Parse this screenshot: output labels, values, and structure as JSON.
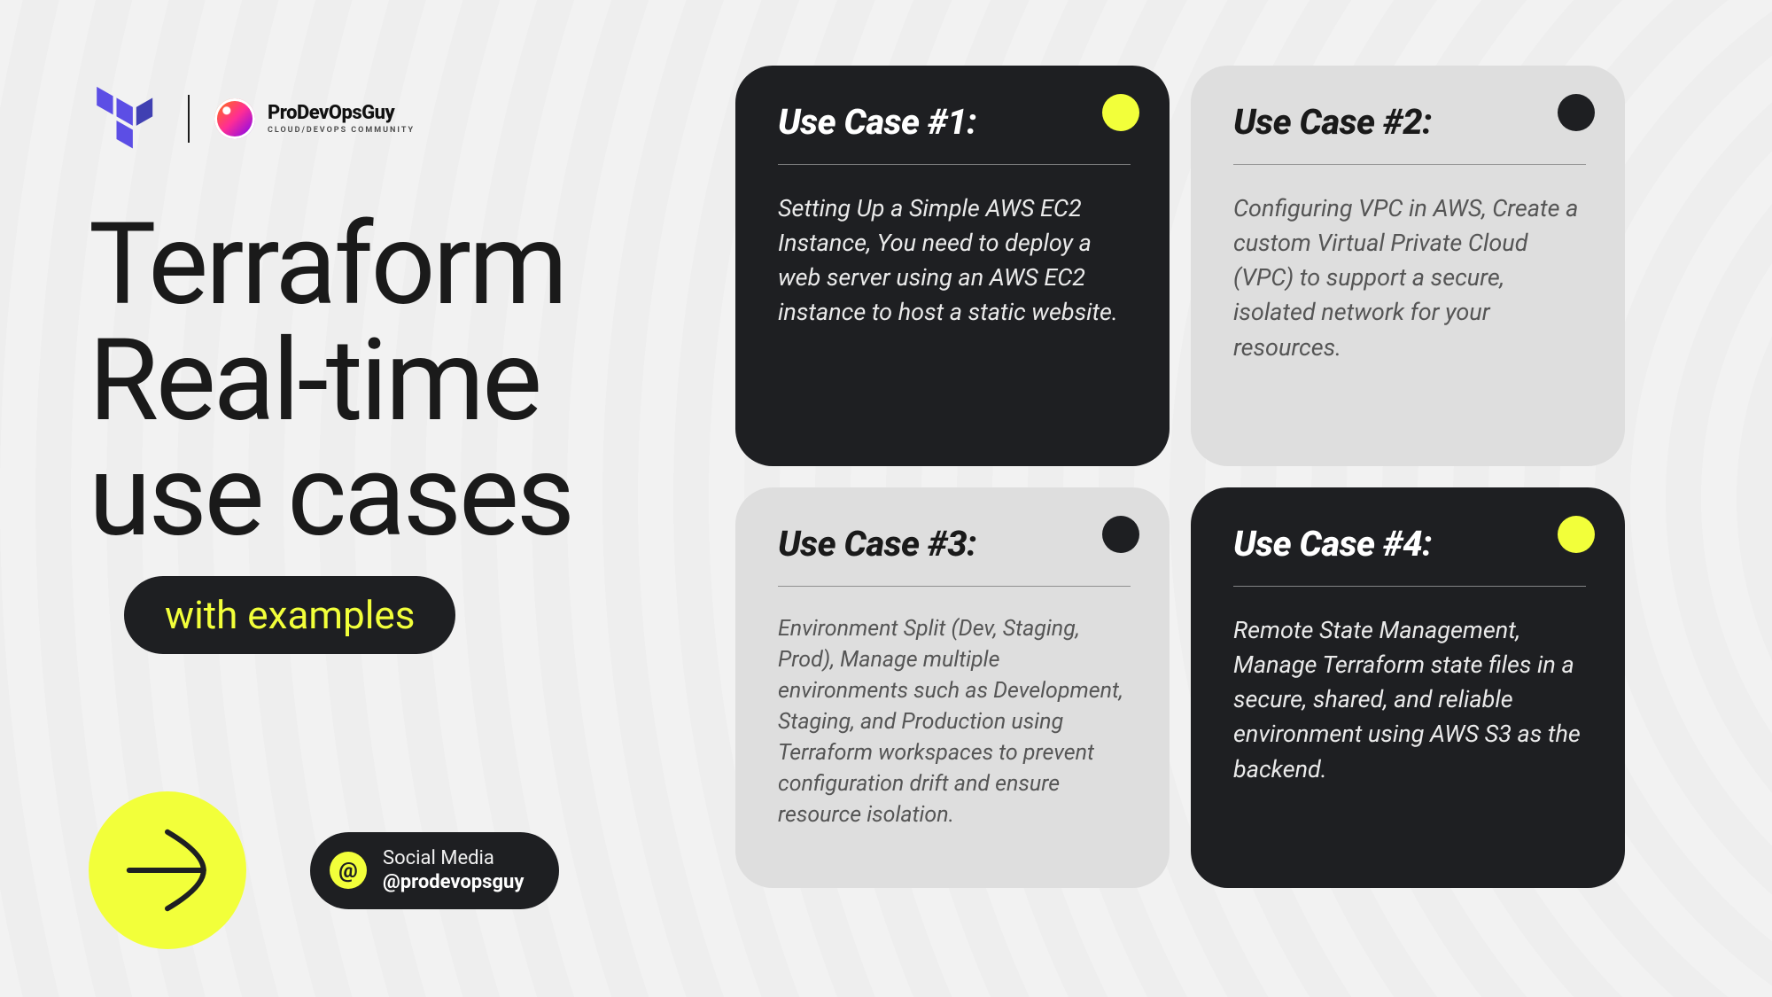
{
  "brand": {
    "name": "ProDevOpsGuy",
    "subtitle": "CLOUD/DEVOPS COMMUNITY"
  },
  "headline": {
    "line1": "Terraform",
    "line2": "Real-time",
    "line3": "use cases",
    "pill": "with examples"
  },
  "social": {
    "at": "@",
    "label": "Social Media",
    "handle": "@prodevopsguy"
  },
  "cards": [
    {
      "title": "Use Case #1:",
      "body": "Setting Up a Simple AWS EC2 Instance, You need to deploy a web server using an AWS EC2 instance to host a static website.",
      "theme": "dark"
    },
    {
      "title": "Use Case #2:",
      "body": "Configuring VPC in AWS, Create a custom Virtual Private Cloud (VPC) to support a secure, isolated network for your resources.",
      "theme": "light"
    },
    {
      "title": "Use Case #3:",
      "body": "Environment Split (Dev, Staging, Prod), Manage multiple environments such as Development, Staging, and Production using Terraform workspaces to prevent configuration drift and ensure resource isolation.",
      "theme": "light"
    },
    {
      "title": "Use Case #4:",
      "body": "Remote State Management, Manage Terraform state files in a secure, shared, and reliable environment using AWS S3 as the backend.",
      "theme": "dark"
    }
  ]
}
